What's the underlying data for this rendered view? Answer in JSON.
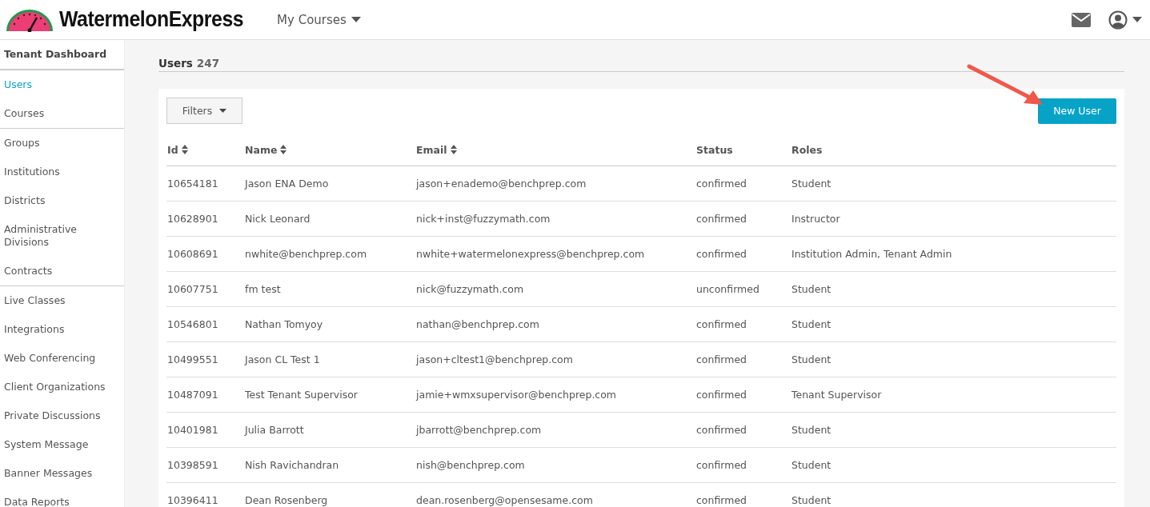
{
  "header": {
    "brand": "WatermelonExpress",
    "menu": "My Courses"
  },
  "sidebar": {
    "title": "Tenant Dashboard",
    "groups": [
      [
        {
          "label": "Users",
          "selected": true
        },
        {
          "label": "Courses",
          "selected": false
        }
      ],
      [
        {
          "label": "Groups",
          "selected": false
        },
        {
          "label": "Institutions",
          "selected": false
        },
        {
          "label": "Districts",
          "selected": false
        },
        {
          "label": "Administrative Divisions",
          "selected": false
        },
        {
          "label": "Contracts",
          "selected": false
        }
      ],
      [
        {
          "label": "Live Classes",
          "selected": false
        },
        {
          "label": "Integrations",
          "selected": false
        },
        {
          "label": "Web Conferencing",
          "selected": false
        },
        {
          "label": "Client Organizations",
          "selected": false
        },
        {
          "label": "Private Discussions",
          "selected": false
        },
        {
          "label": "System Message",
          "selected": false
        },
        {
          "label": "Banner Messages",
          "selected": false
        },
        {
          "label": "Data Reports",
          "selected": false
        }
      ]
    ]
  },
  "page": {
    "title": "Users",
    "count": "247",
    "filters_button": "Filters",
    "new_button": "New User"
  },
  "table": {
    "columns": [
      {
        "label": "Id",
        "sortable": true
      },
      {
        "label": "Name",
        "sortable": true
      },
      {
        "label": "Email",
        "sortable": true
      },
      {
        "label": "Status",
        "sortable": false
      },
      {
        "label": "Roles",
        "sortable": false
      }
    ],
    "rows": [
      [
        "10654181",
        "Jason ENA Demo",
        "jason+enademo@benchprep.com",
        "confirmed",
        "Student"
      ],
      [
        "10628901",
        "Nick Leonard",
        "nick+inst@fuzzymath.com",
        "confirmed",
        "Instructor"
      ],
      [
        "10608691",
        "nwhite@benchprep.com",
        "nwhite+watermelonexpress@benchprep.com",
        "confirmed",
        "Institution Admin, Tenant Admin"
      ],
      [
        "10607751",
        "fm test",
        "nick@fuzzymath.com",
        "unconfirmed",
        "Student"
      ],
      [
        "10546801",
        "Nathan Tomyoy",
        "nathan@benchprep.com",
        "confirmed",
        "Student"
      ],
      [
        "10499551",
        "Jason CL Test 1",
        "jason+cltest1@benchprep.com",
        "confirmed",
        "Student"
      ],
      [
        "10487091",
        "Test Tenant Supervisor",
        "jamie+wmxsupervisor@benchprep.com",
        "confirmed",
        "Tenant Supervisor"
      ],
      [
        "10401981",
        "Julia Barrott",
        "jbarrott@benchprep.com",
        "confirmed",
        "Student"
      ],
      [
        "10398591",
        "Nish Ravichandran",
        "nish@benchprep.com",
        "confirmed",
        "Student"
      ],
      [
        "10396411",
        "Dean Rosenberg",
        "dean.rosenberg@opensesame.com",
        "confirmed",
        "Student"
      ]
    ]
  }
}
